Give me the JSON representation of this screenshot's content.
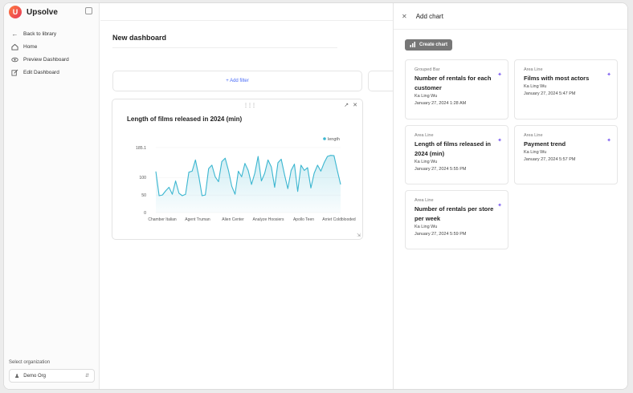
{
  "app": {
    "name": "Upsolve"
  },
  "sidebar": {
    "items": [
      {
        "icon": "arrow-left-icon",
        "label": "Back to library"
      },
      {
        "icon": "home-icon",
        "label": "Home"
      },
      {
        "icon": "eye-icon",
        "label": "Preview Dashboard"
      },
      {
        "icon": "edit-icon",
        "label": "Edit Dashboard"
      }
    ],
    "org_label": "Select organization",
    "org_value": "Demo Org"
  },
  "dashboard": {
    "title": "New dashboard",
    "add_filter": "+ Add filter"
  },
  "chart": {
    "title": "Length of films released in 2024 (min)"
  },
  "chart_data": {
    "type": "area",
    "title": "Length of films released in 2024 (min)",
    "legend": [
      "length"
    ],
    "legend_position": "top-right",
    "y_ticks": [
      "0",
      "50",
      "100",
      "185.1"
    ],
    "ylim": [
      0,
      185.1
    ],
    "x_tick_labels": [
      "Chamber Italian",
      "Agent Truman",
      "Alien Center",
      "Analyze Hoosiers",
      "Apollo Teen",
      "Arriet Coldblooded"
    ],
    "series": [
      {
        "name": "length",
        "color": "#3bb6d0",
        "values": [
          117,
          48,
          50,
          62,
          72,
          52,
          90,
          55,
          48,
          52,
          115,
          118,
          150,
          105,
          48,
          50,
          125,
          135,
          102,
          88,
          145,
          155,
          120,
          75,
          52,
          118,
          102,
          140,
          120,
          80,
          112,
          160,
          90,
          112,
          150,
          130,
          72,
          142,
          152,
          108,
          68,
          120,
          138,
          60,
          135,
          120,
          128,
          70,
          112,
          135,
          118,
          142,
          160,
          163,
          162,
          120,
          80
        ]
      }
    ]
  },
  "panel": {
    "title": "Add chart",
    "create_button": "Create chart",
    "charts": [
      {
        "type": "Grouped Bar",
        "name": "Number of rentals for each customer",
        "author": "Ka Ling Wu",
        "date": "January 27, 2024 1:28 AM"
      },
      {
        "type": "Area Line",
        "name": "Films with most actors",
        "author": "Ka Ling Wu",
        "date": "January 27, 2024 5:47 PM"
      },
      {
        "type": "Area Line",
        "name": "Length of films released in 2024 (min)",
        "author": "Ka Ling Wu",
        "date": "January 27, 2024 5:55 PM"
      },
      {
        "type": "Area Line",
        "name": "Payment trend",
        "author": "Ka Ling Wu",
        "date": "January 27, 2024 5:57 PM"
      },
      {
        "type": "Area Line",
        "name": "Number of rentals per store per week",
        "author": "Ka Ling Wu",
        "date": "January 27, 2024 5:59 PM"
      }
    ]
  }
}
